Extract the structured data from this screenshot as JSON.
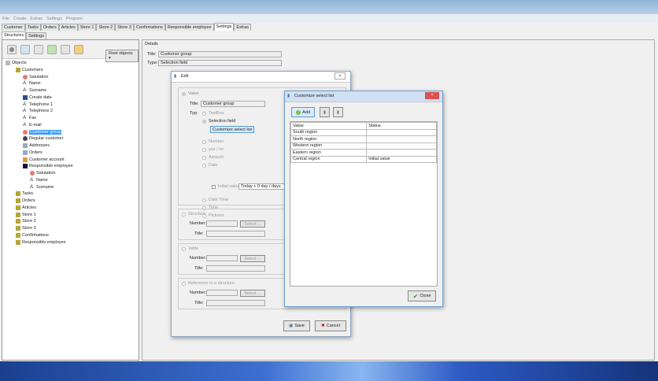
{
  "menu": [
    "File",
    "Create",
    "Extras",
    "Settings",
    "Program"
  ],
  "tabs": [
    "Customer",
    "Tasks",
    "Orders",
    "Articles",
    "Store 1",
    "Store 2",
    "Store 3",
    "Confirmations",
    "Responsible employee",
    "Settings",
    "Extras"
  ],
  "active_tab": "Settings",
  "subtabs": [
    "Structures",
    "Settings"
  ],
  "left": {
    "root_objects_label": "Root objects",
    "tree": [
      {
        "label": "Objects",
        "level": 0,
        "icon": "objects-icon"
      },
      {
        "label": "Customers",
        "level": 1,
        "icon": "folder-icon"
      },
      {
        "label": "Salutation",
        "level": 2,
        "icon": "selection-icon"
      },
      {
        "label": "Name",
        "level": 2,
        "icon": "text-icon"
      },
      {
        "label": "Surname",
        "level": 2,
        "icon": "text-icon"
      },
      {
        "label": "Create date",
        "level": 2,
        "icon": "calendar-icon"
      },
      {
        "label": "Telephone 1",
        "level": 2,
        "icon": "text-icon"
      },
      {
        "label": "Telephone 2",
        "level": 2,
        "icon": "text-icon"
      },
      {
        "label": "Fax",
        "level": 2,
        "icon": "text-icon"
      },
      {
        "label": "E-mail",
        "level": 2,
        "icon": "text-icon"
      },
      {
        "label": "Customer group",
        "level": 2,
        "icon": "selection-icon",
        "selected": true
      },
      {
        "label": "Regular customer",
        "level": 2,
        "icon": "check-icon"
      },
      {
        "label": "Addresses",
        "level": 2,
        "icon": "table-icon"
      },
      {
        "label": "Orders",
        "level": 2,
        "icon": "table-icon"
      },
      {
        "label": "Customer account",
        "level": 2,
        "icon": "link-icon"
      },
      {
        "label": "Responsible employee",
        "level": 2,
        "icon": "reference-icon"
      },
      {
        "label": "Salutation",
        "level": 3,
        "icon": "selection-icon"
      },
      {
        "label": "Name",
        "level": 3,
        "icon": "text-icon"
      },
      {
        "label": "Surname",
        "level": 3,
        "icon": "text-icon"
      },
      {
        "label": "Tasks",
        "level": 1,
        "icon": "folder-icon"
      },
      {
        "label": "Orders",
        "level": 1,
        "icon": "folder-icon"
      },
      {
        "label": "Articles",
        "level": 1,
        "icon": "folder-icon"
      },
      {
        "label": "Store 1",
        "level": 1,
        "icon": "folder-icon"
      },
      {
        "label": "Store 2",
        "level": 1,
        "icon": "folder-icon"
      },
      {
        "label": "Store 3",
        "level": 1,
        "icon": "folder-icon"
      },
      {
        "label": "Confirmations",
        "level": 1,
        "icon": "folder-icon"
      },
      {
        "label": "Responsible employee",
        "level": 1,
        "icon": "folder-icon"
      }
    ]
  },
  "details": {
    "heading": "Details",
    "title_label": "Title:",
    "title_value": "Customer group",
    "type_label": "Type:",
    "type_value": "Selection field"
  },
  "edit": {
    "title": "Edit",
    "value_label": "Value",
    "title_label": "Title:",
    "title_value": "Customer group",
    "type_label": "Typ:",
    "types": [
      "TextBox",
      "Selection field",
      "Number",
      "yes / no",
      "Amount",
      "Date",
      "Date Time",
      "Time",
      "Pictures"
    ],
    "selected_type": "Selection field",
    "customize_btn": "Customize select list",
    "initial_value_label": "Initial value:",
    "initial_value": "Today + 0 day / days",
    "structure_label": "Structure",
    "table_label": "Table",
    "reference_label": "Reference to a structure",
    "number_label": "Number:",
    "title2_label": "Title:",
    "select_btn": "Select ...",
    "save": "Save",
    "cancel": "Cancel"
  },
  "customize": {
    "title": "Customize select list",
    "add": "Add",
    "columns": [
      "Value",
      "Status"
    ],
    "rows": [
      [
        "South region",
        ""
      ],
      [
        "North region",
        ""
      ],
      [
        "Western region",
        ""
      ],
      [
        "Eastern region",
        ""
      ],
      [
        "Central region",
        "Initial value"
      ]
    ],
    "close": "Close"
  }
}
